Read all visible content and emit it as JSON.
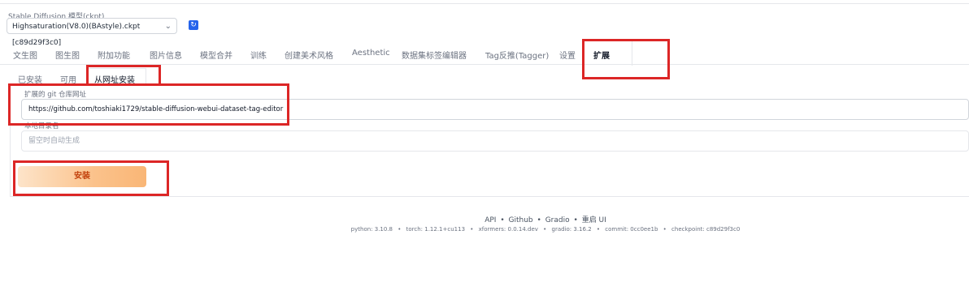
{
  "model": {
    "label": "Stable Diffusion 模型(ckpt)",
    "selected": "Highsaturation(V8.0)(BAstyle).ckpt [c89d29f3c0]",
    "refresh_icon": "refresh-icon"
  },
  "tabs": [
    {
      "label": "文生图"
    },
    {
      "label": "图生图"
    },
    {
      "label": "附加功能"
    },
    {
      "label": "图片信息"
    },
    {
      "label": "模型合并"
    },
    {
      "label": "训练"
    },
    {
      "label": "创建美术风格"
    },
    {
      "label": "Aesthetic"
    },
    {
      "label": "数据集标签编辑器"
    },
    {
      "label": "Tag反推(Tagger)"
    },
    {
      "label": "设置"
    },
    {
      "label": "扩展"
    }
  ],
  "subtabs": [
    {
      "label": "已安装"
    },
    {
      "label": "可用"
    },
    {
      "label": "从网址安装"
    }
  ],
  "form": {
    "url_label": "扩展的 git 仓库网址",
    "url_value": "https://github.com/toshiaki1729/stable-diffusion-webui-dataset-tag-editor",
    "dir_label": "本地目录名",
    "dir_placeholder": "留空时自动生成",
    "install_label": "安装"
  },
  "footer": {
    "links": [
      "API",
      "Github",
      "Gradio",
      "重启 UI"
    ],
    "separator": "•",
    "info": [
      "python: 3.10.8",
      "torch: 1.12.1+cu113",
      "xformers: 0.0.14.dev",
      "gradio: 3.16.2",
      "commit: 0cc0ee1b",
      "checkpoint: c89d29f3c0"
    ]
  },
  "colors": {
    "annotation_red": "#dc2626",
    "install_orange": "#fbc28b",
    "refresh_blue": "#2563eb"
  }
}
